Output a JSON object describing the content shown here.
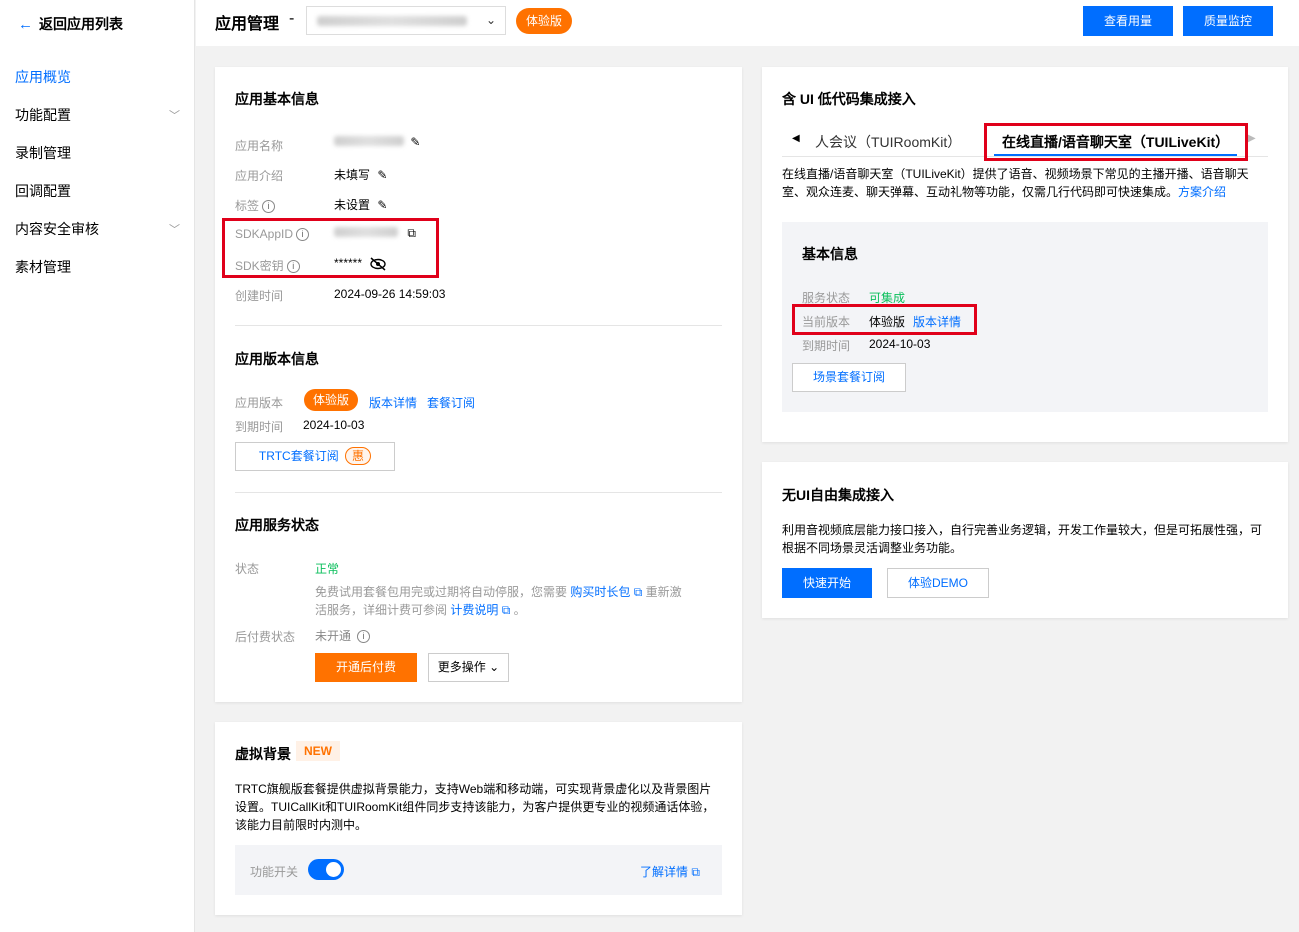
{
  "sidebar": {
    "back_label": "返回应用列表",
    "items": [
      {
        "label": "应用概览"
      },
      {
        "label": "功能配置"
      },
      {
        "label": "录制管理"
      },
      {
        "label": "回调配置"
      },
      {
        "label": "内容安全审核"
      },
      {
        "label": "素材管理"
      }
    ]
  },
  "header": {
    "title": "应用管理",
    "dash": "-",
    "app_edition_badge": "体验版",
    "view_usage_button": "查看用量",
    "quality_monitor_button": "质量监控"
  },
  "basic_info": {
    "title": "应用基本信息",
    "name_label": "应用名称",
    "intro_label": "应用介绍",
    "intro_value": "未填写",
    "tag_label": "标签",
    "tag_value": "未设置",
    "sdkappid_label": "SDKAppID",
    "sdk_key_label": "SDK密钥",
    "sdk_key_value": "******",
    "created_label": "创建时间",
    "created_value": "2024-09-26 14:59:03"
  },
  "version_info": {
    "title": "应用版本信息",
    "version_label": "应用版本",
    "version_badge": "体验版",
    "version_detail_link": "版本详情",
    "package_link": "套餐订阅",
    "expire_label": "到期时间",
    "expire_value": "2024-10-03",
    "trtc_button": "TRTC套餐订阅",
    "trtc_button_tag": "惠"
  },
  "service_status": {
    "title": "应用服务状态",
    "status_label": "状态",
    "status_value": "正常",
    "note_part1": "免费试用套餐包用完或过期将自动停服，您需要",
    "note_link1": "购买时长包",
    "note_part2": "重新激",
    "note_part3": "活服务，详细计费可参阅",
    "note_link2": "计费说明",
    "note_end": "。",
    "postpaid_label": "后付费状态",
    "postpaid_value": "未开通",
    "open_postpaid_button": "开通后付费",
    "more_actions_button": "更多操作"
  },
  "virtual_bg": {
    "title": "虚拟背景",
    "new_tag": "NEW",
    "description": "TRTC旗舰版套餐提供虚拟背景能力，支持Web端和移动端，可实现背景虚化以及背景图片设置。TUICallKit和TUIRoomKit组件同步支持该能力，为客户提供更专业的视频通话体验，该能力目前限时内测中。",
    "switch_label": "功能开关",
    "learn_more_link": "了解详情",
    "switch_on": true
  },
  "low_code": {
    "title": "含 UI 低代码集成接入",
    "tab_left_arrow": "◀",
    "tab_room": "人会议（TUIRoomKit）",
    "tab_live": "在线直播/语音聊天室（TUILiveKit）",
    "tab_right_arrow": "▶",
    "description": "在线直播/语音聊天室（TUILiveKit）提供了语音、视频场景下常见的主播开播、语音聊天室、观众连麦、聊天弹幕、互动礼物等功能，仅需几行代码即可快速集成。",
    "solution_link": "方案介绍",
    "panel_title": "基本信息",
    "service_state_label": "服务状态",
    "service_state_value": "可集成",
    "current_version_label": "当前版本",
    "current_version_value": "体验版",
    "version_detail_link": "版本详情",
    "expire_label": "到期时间",
    "expire_value": "2024-10-03",
    "scene_package_button": "场景套餐订阅"
  },
  "no_ui": {
    "title": "无UI自由集成接入",
    "description": "利用音视频底层能力接口接入，自行完善业务逻辑，开发工作量较大，但是可拓展性强，可根据不同场景灵活调整业务功能。",
    "quick_start_button": "快速开始",
    "demo_button": "体验DEMO"
  },
  "colors": {
    "accent": "#006eff",
    "orange": "#ff7200",
    "green": "#0abf5b",
    "highlight": "#e0001a"
  }
}
